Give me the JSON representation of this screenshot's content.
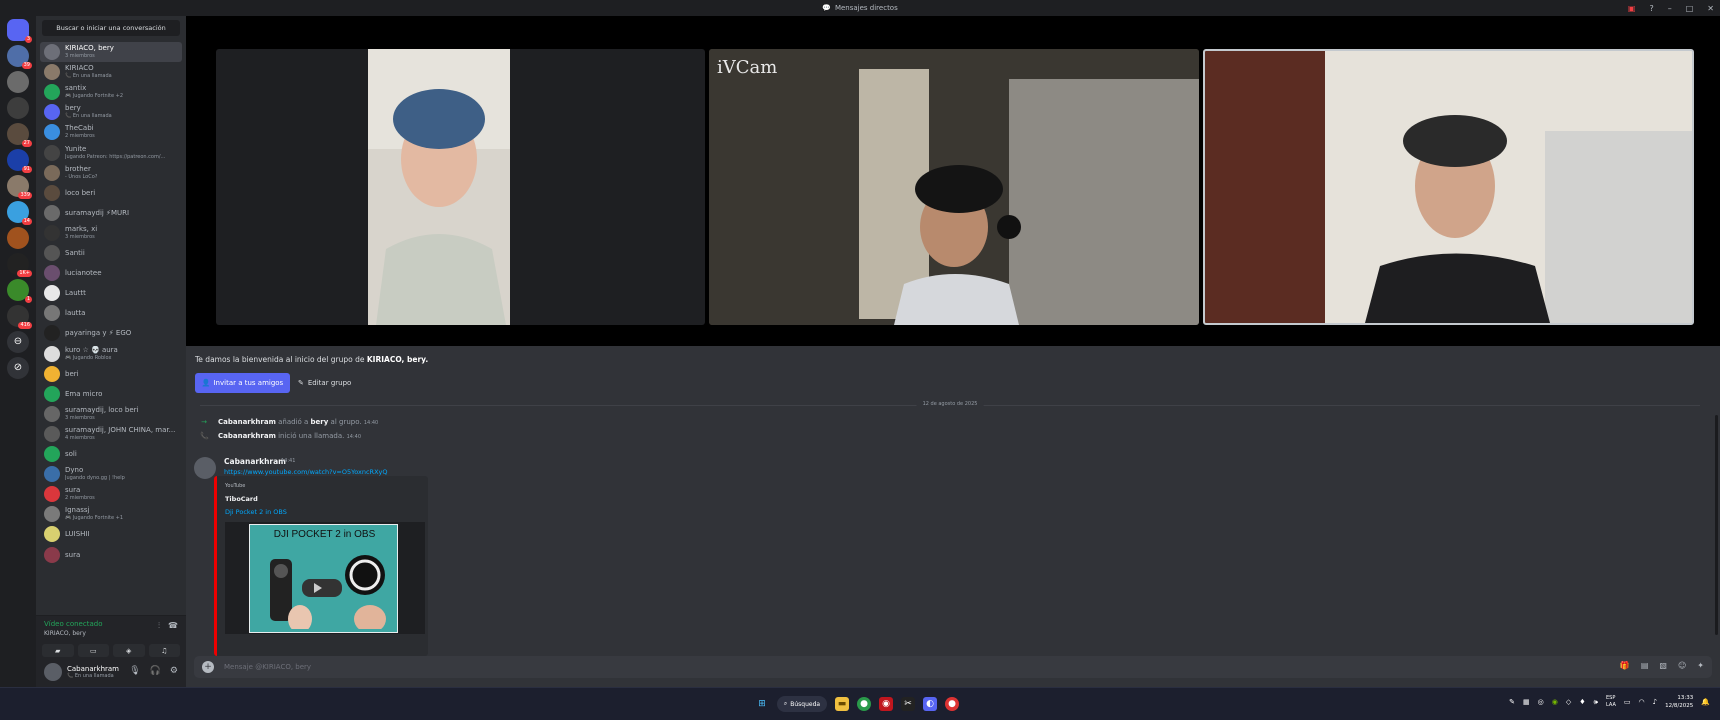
{
  "window": {
    "title": "Mensajes directos"
  },
  "servers": [
    {
      "name": "discord-home",
      "color": "#5865f2",
      "badge": "3"
    },
    {
      "name": "server-1",
      "color": "#4f6ea8",
      "badge": "39"
    },
    {
      "name": "server-2",
      "color": "#6b6b6b",
      "badge": ""
    },
    {
      "name": "server-3",
      "color": "#3d3d3d",
      "badge": ""
    },
    {
      "name": "server-4",
      "color": "#5a4b3e",
      "badge": "27"
    },
    {
      "name": "server-5",
      "color": "#1b3fa8",
      "badge": "91"
    },
    {
      "name": "server-6",
      "color": "#8a7a6a",
      "badge": "339"
    },
    {
      "name": "server-7",
      "color": "#3aa0e0",
      "badge": "14"
    },
    {
      "name": "server-8",
      "color": "#a0521e",
      "badge": ""
    },
    {
      "name": "server-9",
      "color": "#222",
      "badge": "1K+"
    },
    {
      "name": "server-10",
      "color": "#3a8a2a",
      "badge": "1"
    },
    {
      "name": "server-11",
      "color": "#333",
      "badge": "416"
    }
  ],
  "sidebar": {
    "search_label": "Buscar o iniciar una conversación",
    "dms": [
      {
        "name": "KIRIACO, bery",
        "sub": "3 miembros",
        "color": "#6d6f78",
        "active": true
      },
      {
        "name": "KIRIACO",
        "sub": "📞 En una llamada",
        "color": "#8a7a6a",
        "active": false
      },
      {
        "name": "santix",
        "sub": "🎮 Jugando Fortnite +2",
        "color": "#23a55a",
        "active": false
      },
      {
        "name": "bery",
        "sub": "📞 En una llamada",
        "color": "#5865f2",
        "active": false
      },
      {
        "name": "TheCabi",
        "sub": "2 miembros",
        "color": "#3a8ee0",
        "active": false
      },
      {
        "name": "Yunite",
        "sub": "Jugando Patreon: https://patreon.com/...",
        "color": "#444",
        "active": false
      },
      {
        "name": "brother",
        "sub": "- Unos LoCo?",
        "color": "#7a6a5a",
        "active": false
      },
      {
        "name": "loco beri",
        "sub": "",
        "color": "#5a4b3e",
        "active": false
      },
      {
        "name": "suramaydij ⚡MURI",
        "sub": "",
        "color": "#6a6a6a",
        "active": false
      },
      {
        "name": "marks, xi",
        "sub": "3 miembros",
        "color": "#333",
        "active": false
      },
      {
        "name": "Santii",
        "sub": "",
        "color": "#555",
        "active": false
      },
      {
        "name": "lucianotee",
        "sub": "",
        "color": "#6a4e6e",
        "active": false
      },
      {
        "name": "Lauttt",
        "sub": "",
        "color": "#e8e8e8",
        "active": false
      },
      {
        "name": "lautta",
        "sub": "",
        "color": "#777",
        "active": false
      },
      {
        "name": "payaringa y ⚡ EGO",
        "sub": "",
        "color": "#222",
        "active": false
      },
      {
        "name": "kuro ☆ 💀 aura",
        "sub": "🎮 Jugando Roblox",
        "color": "#ddd",
        "active": false
      },
      {
        "name": "beri",
        "sub": "",
        "color": "#f0b232",
        "active": false
      },
      {
        "name": "Ema micro",
        "sub": "",
        "color": "#23a55a",
        "active": false
      },
      {
        "name": "suramaydij, loco beri",
        "sub": "3 miembros",
        "color": "#666",
        "active": false
      },
      {
        "name": "suramaydij, JOHN CHINA, mar...",
        "sub": "4 miembros",
        "color": "#5a5a5a",
        "active": false
      },
      {
        "name": "soli",
        "sub": "",
        "color": "#23a55a",
        "active": false
      },
      {
        "name": "Dyno",
        "sub": "Jugando dyno.gg | !help",
        "color": "#3a6ea8",
        "active": false
      },
      {
        "name": "sura",
        "sub": "2 miembros",
        "color": "#da373c",
        "active": false
      },
      {
        "name": "Ignassj",
        "sub": "🎮 Jugando Fortnite +1",
        "color": "#7a7a7a",
        "active": false
      },
      {
        "name": "LUISHII",
        "sub": "",
        "color": "#d8d070",
        "active": false
      },
      {
        "name": "sura",
        "sub": "",
        "color": "#8a3a4a",
        "active": false
      }
    ]
  },
  "voice": {
    "status": "Vídeo conectado",
    "channel": "KIRIACO, bery"
  },
  "user": {
    "name": "Cabanarkhram",
    "status": "📞 En una llamada"
  },
  "call": {
    "overlay_text": "iVCam"
  },
  "welcome": {
    "prefix": "Te damos la bienvenida al inicio del grupo de ",
    "group": "KIRIACO, bery."
  },
  "buttons": {
    "invite": "Invitar a tus amigos",
    "edit": "Editar grupo"
  },
  "date_divider": "12 de agosto de 2025",
  "system_messages": [
    {
      "icon": "→",
      "icon_color": "#23a55a",
      "actor": "Cabanarkhram",
      "text1": " añadió a ",
      "target": "bery",
      "text2": " al grupo.",
      "time": "14:40"
    },
    {
      "icon": "📞",
      "icon_color": "#23a55a",
      "actor": "Cabanarkhram",
      "text1": " inició una llamada.",
      "target": "",
      "text2": "",
      "time": "14:40"
    }
  ],
  "message": {
    "author": "Cabanarkhram",
    "time": "14:41",
    "link": "https://www.youtube.com/watch?v=O5YoxncRXyQ",
    "embed": {
      "provider": "YouTube",
      "author": "TiboCard",
      "title": "Dji Pocket 2 in OBS",
      "thumbnail_text": "DJI POCKET 2 in OBS"
    }
  },
  "composer": {
    "placeholder": "Mensaje @KIRIACO, bery"
  },
  "taskbar": {
    "search_label": "Búsqueda",
    "lang1": "ESP",
    "lang2": "LAA",
    "time": "13:33",
    "date": "12/8/2025"
  }
}
